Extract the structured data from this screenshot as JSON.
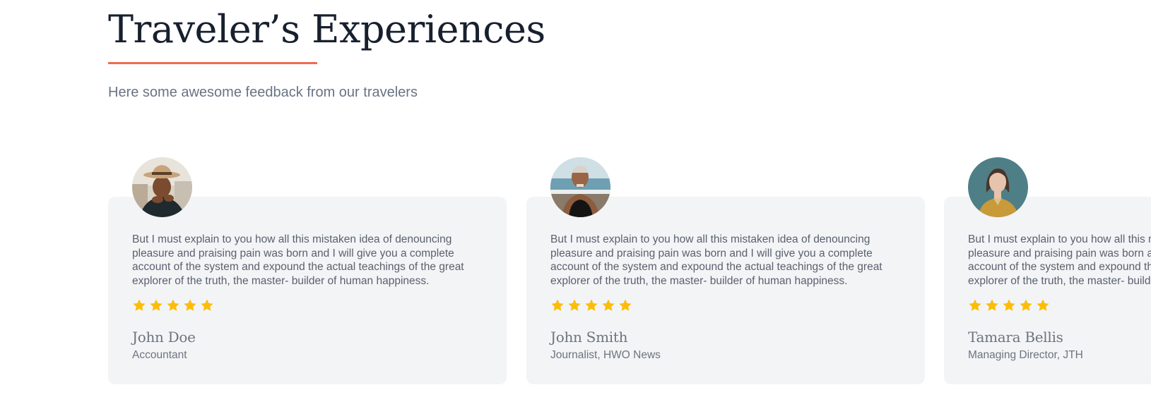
{
  "section": {
    "title": "Traveler’s Experiences",
    "subtitle": "Here some awesome feedback from our travelers"
  },
  "colors": {
    "accent": "#f26a4b",
    "star": "#fbbd08",
    "card_bg": "#f3f4f6",
    "title": "#18202e",
    "muted_text": "#697383"
  },
  "testimonials": [
    {
      "quote_lines": [
        "But I must explain to you how all this mistaken idea of denouncing",
        "pleasure and praising pain was born and I will give you a complete",
        "account of the system and expound the actual teachings of the great",
        "explorer of the truth, the master- builder of human happiness."
      ],
      "rating": 5,
      "name": "John Doe",
      "role": "Accountant"
    },
    {
      "quote_lines": [
        "But I must explain to you how all this mistaken idea of denouncing",
        "pleasure and praising pain was born and I will give you a complete",
        "account of the system and expound the actual teachings of the great",
        "explorer of the truth, the master- builder of human happiness."
      ],
      "rating": 5,
      "name": "John Smith",
      "role": "Journalist, HWO News"
    },
    {
      "quote_lines": [
        "But I must explain to you how all this mistaken idea of denouncing",
        "pleasure and praising pain was born and I will give you a complete",
        "account of the system and expound the actual teachings of the great",
        "explorer of the truth, the master- builder of human happiness."
      ],
      "rating": 5,
      "name": "Tamara Bellis",
      "role": "Managing Director, JTH"
    }
  ]
}
